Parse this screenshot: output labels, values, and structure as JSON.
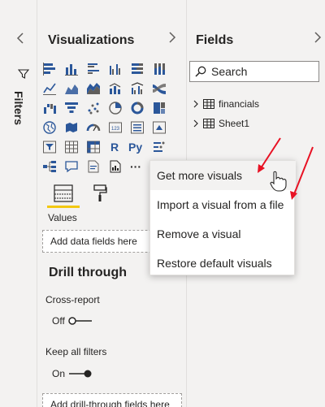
{
  "filters": {
    "label": "Filters",
    "collapse_icon": "chevron-left-icon",
    "funnel_icon": "funnel-icon"
  },
  "visualizations": {
    "title": "Visualizations",
    "expand_icon": "chevron-right-icon",
    "grid_icons": [
      "stacked-bar-chart",
      "stacked-column-chart",
      "clustered-bar-chart",
      "clustered-column-chart",
      "100-stacked-bar-chart",
      "100-stacked-column-chart",
      "line-chart",
      "area-chart",
      "stacked-area-chart",
      "line-and-stacked-column-chart",
      "line-and-clustered-column-chart",
      "ribbon-chart",
      "waterfall-chart",
      "funnel-chart",
      "scatter-chart",
      "pie-chart",
      "donut-chart",
      "treemap",
      "map",
      "filled-map",
      "gauge",
      "card",
      "multi-row-card",
      "kpi",
      "slicer",
      "table",
      "matrix",
      "r-script-visual",
      "python-visual",
      "key-influencers",
      "decomposition-tree",
      "qna",
      "smart-narrative",
      "paginated-report",
      "more-options"
    ],
    "r_label": "R",
    "py_label": "Py",
    "more_label": "···",
    "tabs": [
      "fields-tab",
      "format-tab"
    ],
    "values_label": "Values",
    "values_placeholder": "Add data fields here",
    "drill_through_title": "Drill through",
    "cross_report_label": "Cross-report",
    "cross_report_state": "Off",
    "keep_all_filters_label": "Keep all filters",
    "keep_all_filters_state": "On",
    "drill_placeholder": "Add drill-through fields here"
  },
  "fields": {
    "title": "Fields",
    "expand_icon": "chevron-right-icon",
    "search_placeholder": "Search",
    "tables": [
      {
        "name": "financials"
      },
      {
        "name": "Sheet1"
      }
    ]
  },
  "context_menu": {
    "items": [
      {
        "label": "Get more visuals",
        "hovered": true
      },
      {
        "label": "Import a visual from a file",
        "hovered": false
      },
      {
        "label": "Remove a visual",
        "hovered": false
      },
      {
        "label": "Restore default visuals",
        "hovered": false
      }
    ]
  },
  "colors": {
    "pane_bg": "#f3f2f1",
    "accent_yellow": "#f2c811",
    "icon_blue": "#2b579a",
    "arrow_red": "#e81123"
  }
}
